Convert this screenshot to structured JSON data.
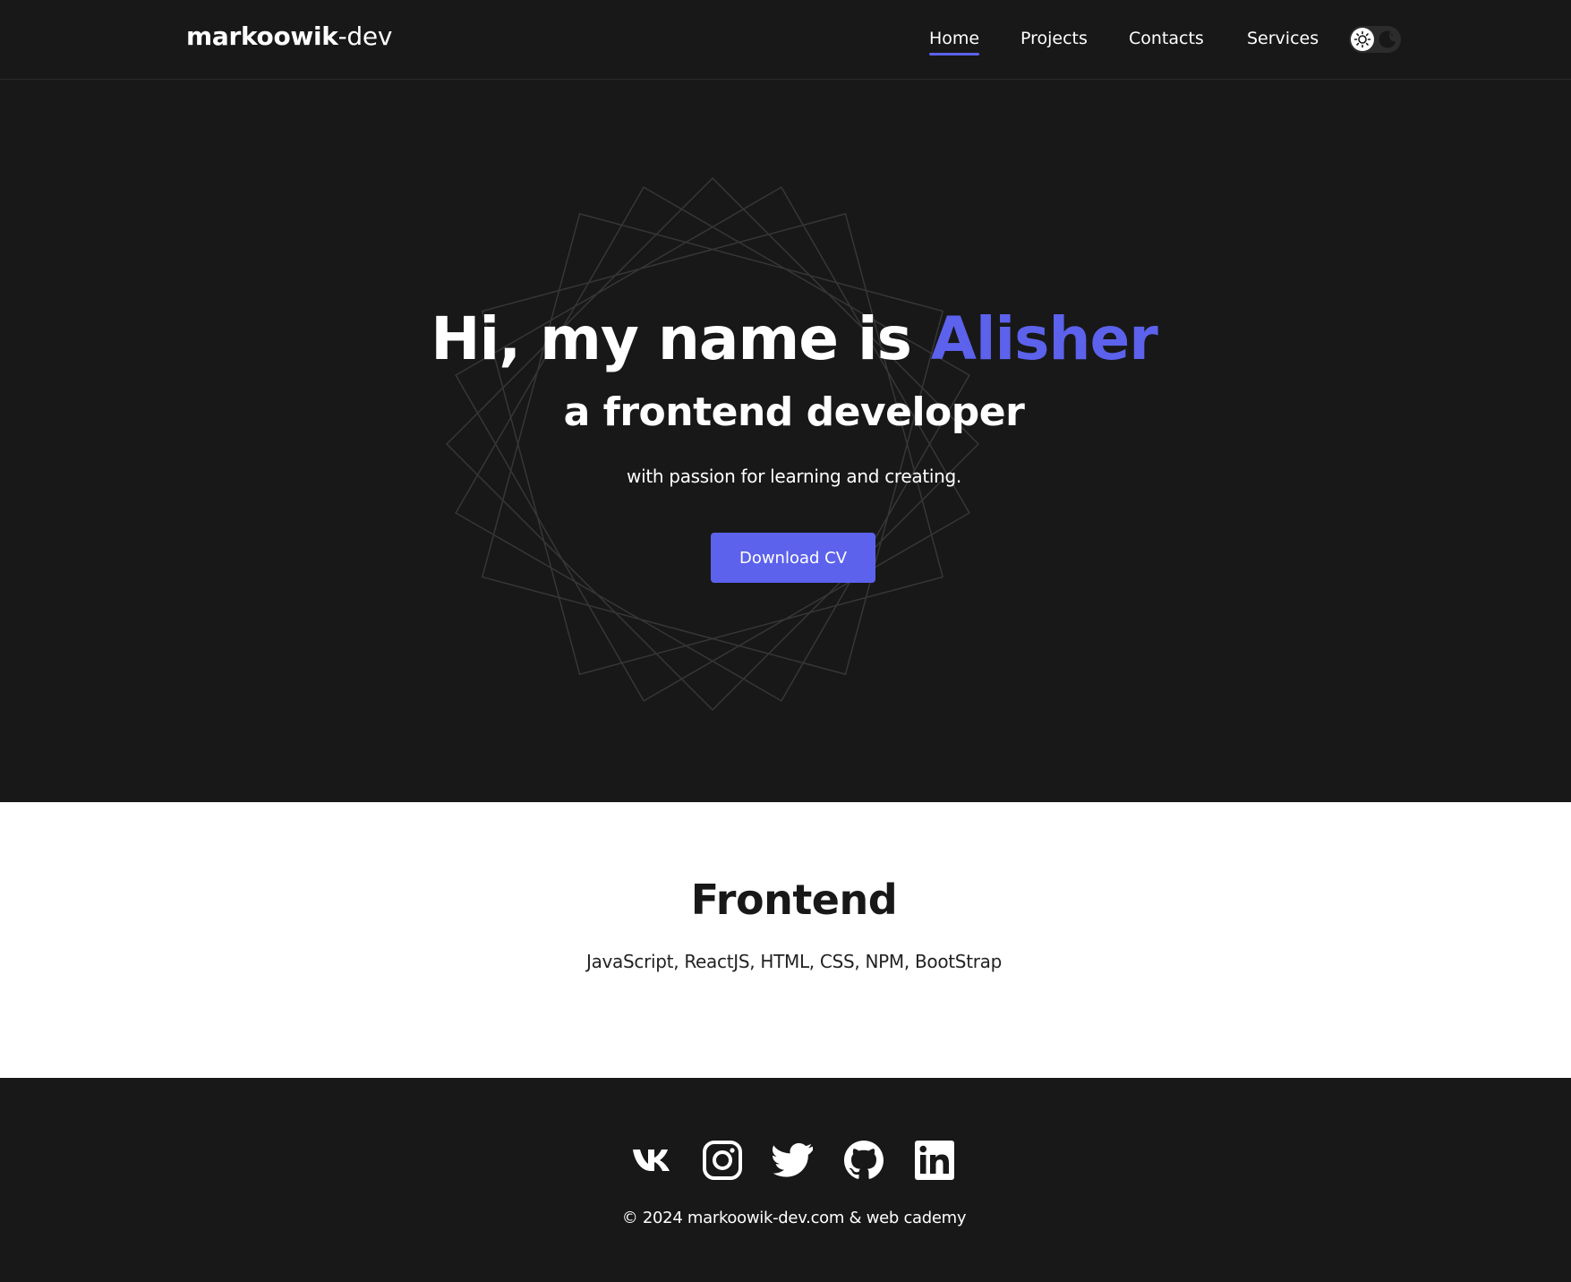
{
  "header": {
    "logo_main": "markoowik",
    "logo_suffix": "-dev",
    "nav": [
      {
        "label": "Home",
        "active": true
      },
      {
        "label": "Projects",
        "active": false
      },
      {
        "label": "Contacts",
        "active": false
      },
      {
        "label": "Services",
        "active": false
      }
    ],
    "theme_toggle": {
      "icons": [
        "sun-icon",
        "moon-icon"
      ],
      "mode": "dark"
    }
  },
  "hero": {
    "title_prefix": "Hi, my name is ",
    "title_name": "Alisher",
    "subtitle": "a frontend developer",
    "text": "with passion for learning and creating.",
    "button_label": "Download CV"
  },
  "skills": {
    "title": "Frontend",
    "list": "JavaScript, ReactJS, HTML, CSS, NPM, BootStrap"
  },
  "footer": {
    "socials": [
      "vk-icon",
      "instagram-icon",
      "twitter-icon",
      "github-icon",
      "linkedin-icon"
    ],
    "copyright": "© 2024 markoowik-dev.com & web cademy"
  },
  "colors": {
    "background": "#181818",
    "accent": "#5c62ec",
    "text_light": "#ffffff",
    "section_light": "#ffffff"
  }
}
